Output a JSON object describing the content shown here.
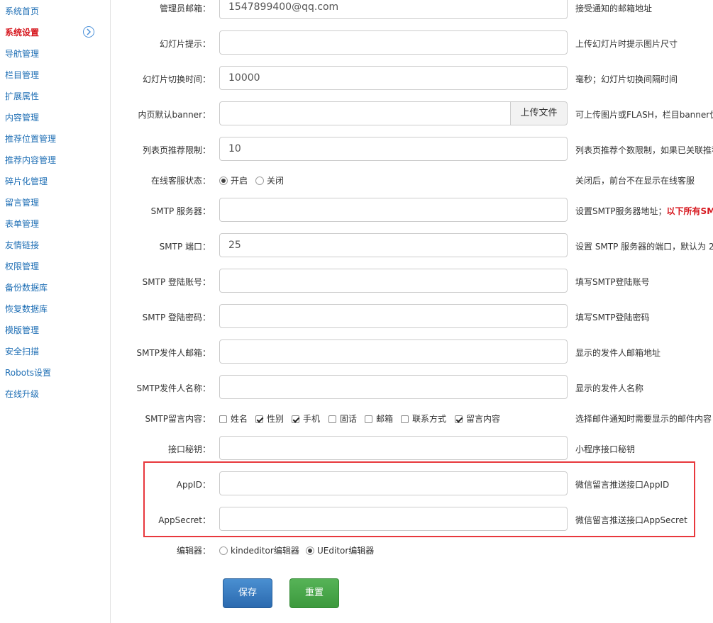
{
  "sidebar": {
    "items": [
      {
        "label": "系统首页"
      },
      {
        "label": "系统设置"
      },
      {
        "label": "导航管理"
      },
      {
        "label": "栏目管理"
      },
      {
        "label": "扩展属性"
      },
      {
        "label": "内容管理"
      },
      {
        "label": "推荐位置管理"
      },
      {
        "label": "推荐内容管理"
      },
      {
        "label": "碎片化管理"
      },
      {
        "label": "留言管理"
      },
      {
        "label": "表单管理"
      },
      {
        "label": "友情链接"
      },
      {
        "label": "权限管理"
      },
      {
        "label": "备份数据库"
      },
      {
        "label": "恢复数据库"
      },
      {
        "label": "模版管理"
      },
      {
        "label": "安全扫描"
      },
      {
        "label": "Robots设置"
      },
      {
        "label": "在线升级"
      }
    ],
    "active_index": 1,
    "active_icon": "chevron-right-circle-icon"
  },
  "form": {
    "admin_email": {
      "label": "管理员邮箱：",
      "value": "1547899400@qq.com",
      "hint": "接受通知的邮箱地址"
    },
    "slide_tip": {
      "label": "幻灯片提示：",
      "value": "",
      "hint": "上传幻灯片时提示图片尺寸"
    },
    "slide_interval": {
      "label": "幻灯片切换时间：",
      "value": "10000",
      "hint": "毫秒；幻灯片切换间隔时间"
    },
    "inner_banner": {
      "label": "内页默认banner：",
      "value": "",
      "button": "上传文件",
      "hint": "可上传图片或FLASH，栏目banner优"
    },
    "list_limit": {
      "label": "列表页推荐限制：",
      "value": "10",
      "hint": "列表页推荐个数限制，如果已关联推荐"
    },
    "online_service": {
      "label": "在线客服状态：",
      "options": [
        "开启",
        "关闭"
      ],
      "selected": "开启",
      "hint": "关闭后，前台不在显示在线客服"
    },
    "smtp_server": {
      "label": "SMTP 服务器：",
      "value": "",
      "hint": "设置SMTP服务器地址；",
      "hint_red": "以下所有SM"
    },
    "smtp_port": {
      "label": "SMTP 端口：",
      "value": "25",
      "hint": "设置 SMTP 服务器的端口，默认为 2"
    },
    "smtp_account": {
      "label": "SMTP 登陆账号：",
      "value": "",
      "hint": "填写SMTP登陆账号"
    },
    "smtp_password": {
      "label": "SMTP 登陆密码：",
      "value": "",
      "hint": "填写SMTP登陆密码"
    },
    "smtp_sender_email": {
      "label": "SMTP发件人邮箱：",
      "value": "",
      "hint": "显示的发件人邮箱地址"
    },
    "smtp_sender_name": {
      "label": "SMTP发件人名称：",
      "value": "",
      "hint": "显示的发件人名称"
    },
    "smtp_message": {
      "label": "SMTP留言内容：",
      "options": [
        {
          "label": "姓名",
          "checked": false
        },
        {
          "label": "性别",
          "checked": true
        },
        {
          "label": "手机",
          "checked": true
        },
        {
          "label": "固话",
          "checked": false
        },
        {
          "label": "邮箱",
          "checked": false
        },
        {
          "label": "联系方式",
          "checked": false
        },
        {
          "label": "留言内容",
          "checked": true
        }
      ],
      "hint": "选择邮件通知时需要显示的邮件内容"
    },
    "api_secret": {
      "label": "接口秘钥：",
      "value": "",
      "hint": "小程序接口秘钥"
    },
    "app_id": {
      "label": "AppID：",
      "value": "",
      "hint": "微信留言推送接口AppID"
    },
    "app_secret": {
      "label": "AppSecret：",
      "value": "",
      "hint": "微信留言推送接口AppSecret"
    },
    "editor": {
      "label": "编辑器：",
      "options": [
        "kindeditor编辑器",
        "UEditor编辑器"
      ],
      "selected": "UEditor编辑器"
    }
  },
  "actions": {
    "save": "保存",
    "reset": "重置"
  },
  "colors": {
    "link": "#1f6fb5",
    "active": "#d6161d",
    "highlight_border": "#e8383d",
    "save_button": "#2b6aaf",
    "reset_button": "#3c993d"
  }
}
